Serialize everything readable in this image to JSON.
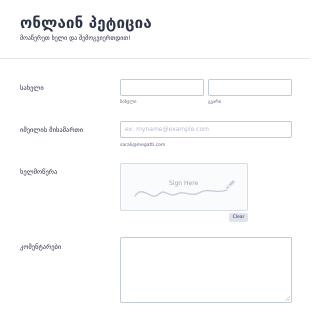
{
  "form": {
    "title": "ონლაინ პეტიცია",
    "subtitle": "მოაწერეთ ხელი და შემოგვიერთდით!"
  },
  "fields": {
    "name": {
      "label": "სახელი",
      "first_sublabel": "სახელი",
      "last_sublabel": "გვარი",
      "first_value": "",
      "last_value": ""
    },
    "email": {
      "label": "იმეილის მისამართი",
      "placeholder": "ex: myname@example.com",
      "value": "",
      "sublabel": "sarali@megatti.com"
    },
    "signature": {
      "label": "ხელმოწერა",
      "prompt": "Sign Here",
      "clear_label": "Clear"
    },
    "comments": {
      "label": "კომენტარები",
      "value": ""
    }
  },
  "colors": {
    "text": "#2c3345",
    "border": "#c3cad8",
    "signature_stroke": "#c8cfdc"
  },
  "icons": {
    "signature": "pen-icon"
  }
}
